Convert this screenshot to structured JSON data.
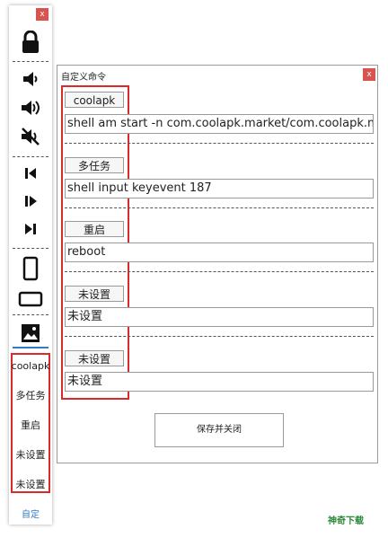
{
  "sidebar": {
    "close_label": "x",
    "icons": [
      "lock-icon",
      "volume-down-icon",
      "volume-up-icon",
      "mute-icon",
      "prev-track-icon",
      "play-pause-icon",
      "next-track-icon",
      "portrait-icon",
      "landscape-icon",
      "image-icon"
    ],
    "shortcuts": [
      "coolapk",
      "多任务",
      "重启",
      "未设置",
      "未设置"
    ],
    "custom_label": "自定"
  },
  "dialog": {
    "title": "自定义命令",
    "close_label": "x",
    "commands": [
      {
        "name": "coolapk",
        "command": "shell am start -n com.coolapk.market/com.coolapk.market"
      },
      {
        "name": "多任务",
        "command": "shell input keyevent 187"
      },
      {
        "name": "重启",
        "command": "reboot"
      },
      {
        "name": "未设置",
        "command": "未设置"
      },
      {
        "name": "未设置",
        "command": "未设置"
      }
    ],
    "save_label": "保存并关闭"
  },
  "watermark": "神奇下载",
  "colors": {
    "close": "#d9534f",
    "highlight": "#d92b2b",
    "accent": "#2f7cc7"
  }
}
